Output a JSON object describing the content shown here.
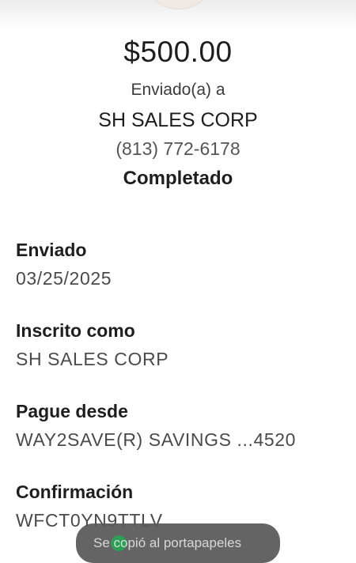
{
  "payment": {
    "amount": "$500.00",
    "sent_to_label": "Enviado(a) a",
    "recipient": "SH SALES CORP",
    "phone": "(813) 772-6178",
    "status": "Completado"
  },
  "details": [
    {
      "label": "Enviado",
      "value": "03/25/2025"
    },
    {
      "label": "Inscrito como",
      "value": "SH SALES CORP"
    },
    {
      "label": "Pague desde",
      "value": "WAY2SAVE(R) SAVINGS ...4520"
    },
    {
      "label": "Confirmación",
      "value": "WFCT0YN9TTLV"
    }
  ],
  "snackbar": {
    "text": "Se copió al portapapeles"
  },
  "colors": {
    "snackbar_icon": "#2e9e57"
  }
}
